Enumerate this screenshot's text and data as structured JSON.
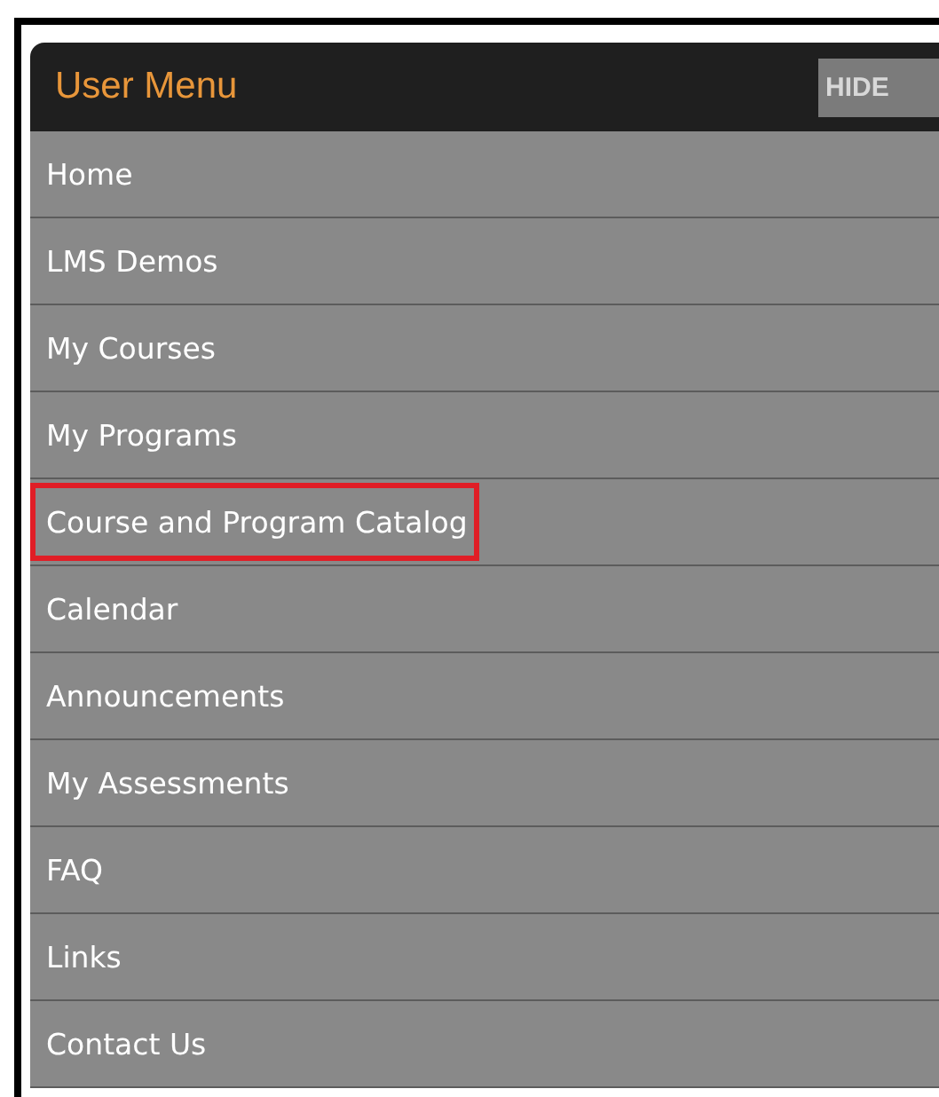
{
  "menu": {
    "title": "User Menu",
    "hide_button": "HIDE",
    "items": [
      {
        "label": "Home",
        "highlighted": false
      },
      {
        "label": "LMS Demos",
        "highlighted": false
      },
      {
        "label": "My Courses",
        "highlighted": false
      },
      {
        "label": "My Programs",
        "highlighted": false
      },
      {
        "label": "Course and Program Catalog",
        "highlighted": true
      },
      {
        "label": "Calendar",
        "highlighted": false
      },
      {
        "label": "Announcements",
        "highlighted": false
      },
      {
        "label": "My Assessments",
        "highlighted": false
      },
      {
        "label": "FAQ",
        "highlighted": false
      },
      {
        "label": "Links",
        "highlighted": false
      },
      {
        "label": "Contact Us",
        "highlighted": false
      }
    ]
  }
}
